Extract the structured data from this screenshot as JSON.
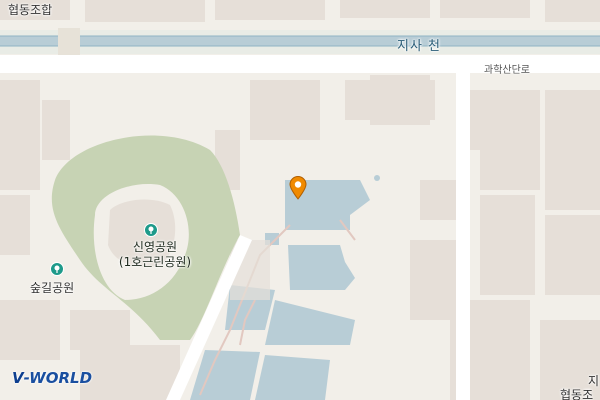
{
  "map": {
    "labels": {
      "top_left": "협동조합",
      "river": "지사 천",
      "road": "과학산단로",
      "park_main_line1": "신영공원",
      "park_main_line2": "(1호근린공원)",
      "park_small": "숲길공원",
      "bottom_right_1": "지",
      "bottom_right_2": "협동조"
    },
    "icons": {
      "park_poi": "tree-icon",
      "location_marker": "map-pin-icon"
    },
    "colors": {
      "background": "#f2efe9",
      "building": "#e6dfd8",
      "park": "#c7d3b4",
      "water": "#b8cdd6",
      "road": "#ffffff",
      "marker": "#f08a00"
    }
  },
  "logo": {
    "text": "-WORLD",
    "mark": "V"
  }
}
